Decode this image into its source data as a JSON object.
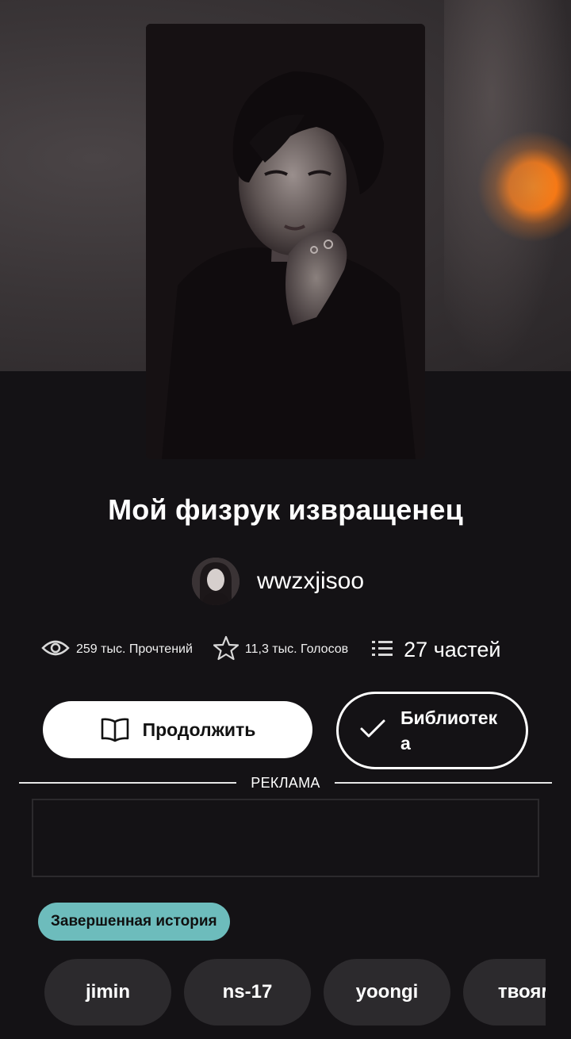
{
  "story": {
    "title": "Мой физрук извращенец",
    "author": "wwzxjisoo"
  },
  "stats": {
    "reads": "259 тыс. Прочтений",
    "votes": "11,3 тыс. Голосов",
    "parts": "27 частей"
  },
  "actions": {
    "continue_label": "Продолжить",
    "library_label": "Библиотека"
  },
  "ad": {
    "label": "РЕКЛАМА"
  },
  "status_badge": "Завершенная история",
  "tags": [
    "jimin",
    "ns-17",
    "yoongi",
    "твоям"
  ],
  "icons": {
    "reads": "eye-icon",
    "votes": "star-icon",
    "parts": "list-icon",
    "continue": "book-icon",
    "library": "check-icon"
  },
  "colors": {
    "background": "#141215",
    "status_badge": "#6dbcbc",
    "tag_bg": "#2c2a2d"
  }
}
